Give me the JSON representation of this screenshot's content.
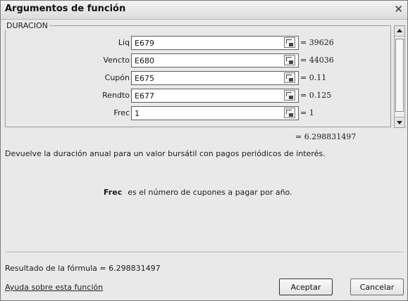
{
  "window": {
    "title": "Argumentos de función"
  },
  "function_name": "DURACION",
  "arguments": [
    {
      "label": "Liq",
      "value": "E679",
      "result": "= 39626"
    },
    {
      "label": "Vencto",
      "value": "E680",
      "result": "= 44036"
    },
    {
      "label": "Cupón",
      "value": "E675",
      "result": "= 0.11"
    },
    {
      "label": "Rendto",
      "value": "E677",
      "result": "= 0.125"
    },
    {
      "label": "Frec",
      "value": "1",
      "result": "= 1"
    }
  ],
  "function_result": "= 6.298831497",
  "description": "Devuelve la duración anual para  un valor bursátil con pagos periódicos de interés.",
  "arg_help": {
    "name": "Frec",
    "text": "es el número de cupones a pagar por año."
  },
  "formula_result": "Resultado de la fórmula =   6.298831497",
  "help_link": "Ayuda sobre esta función",
  "buttons": {
    "ok": "Aceptar",
    "cancel": "Cancelar"
  }
}
